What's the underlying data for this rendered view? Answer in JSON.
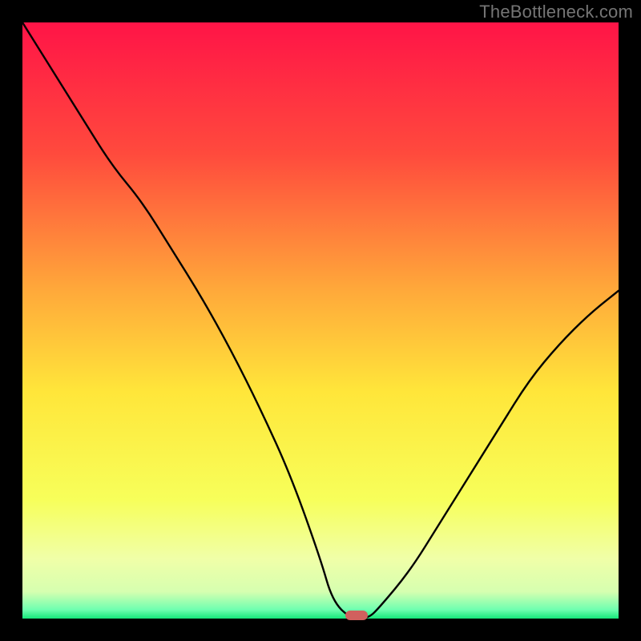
{
  "watermark": {
    "text": "TheBottleneck.com"
  },
  "colors": {
    "frame_bg": "#000000",
    "watermark": "#757575",
    "curve_stroke": "#000000",
    "marker_fill": "#d1605e",
    "gradient_stops": [
      {
        "offset": 0.0,
        "color": "#ff1447"
      },
      {
        "offset": 0.22,
        "color": "#ff4a3d"
      },
      {
        "offset": 0.45,
        "color": "#ffa93a"
      },
      {
        "offset": 0.62,
        "color": "#ffe63a"
      },
      {
        "offset": 0.8,
        "color": "#f7ff5a"
      },
      {
        "offset": 0.9,
        "color": "#f0ffa8"
      },
      {
        "offset": 0.955,
        "color": "#d6ffb0"
      },
      {
        "offset": 0.985,
        "color": "#6fffb0"
      },
      {
        "offset": 1.0,
        "color": "#15e77a"
      }
    ]
  },
  "chart_data": {
    "type": "line",
    "title": "",
    "xlabel": "",
    "ylabel": "",
    "xlim": [
      0,
      100
    ],
    "ylim": [
      0,
      100
    ],
    "grid": false,
    "legend": false,
    "description": "Black V-shaped bottleneck curve over a vertical red-to-yellow-to-green gradient. Curve descends from top-left to a minimum near x≈55, y≈0 then rises to the right edge around y≈55. A small rounded red marker sits at the minimum.",
    "series": [
      {
        "name": "bottleneck-curve",
        "x": [
          0,
          5,
          10,
          15,
          20,
          25,
          30,
          35,
          40,
          45,
          50,
          52,
          55,
          58,
          60,
          65,
          70,
          75,
          80,
          85,
          90,
          95,
          100
        ],
        "y": [
          100,
          92,
          84,
          76,
          70,
          62,
          54,
          45,
          35,
          24,
          10,
          3,
          0,
          0,
          2,
          8,
          16,
          24,
          32,
          40,
          46,
          51,
          55
        ]
      }
    ],
    "marker": {
      "x": 56,
      "y": 0.5
    }
  }
}
